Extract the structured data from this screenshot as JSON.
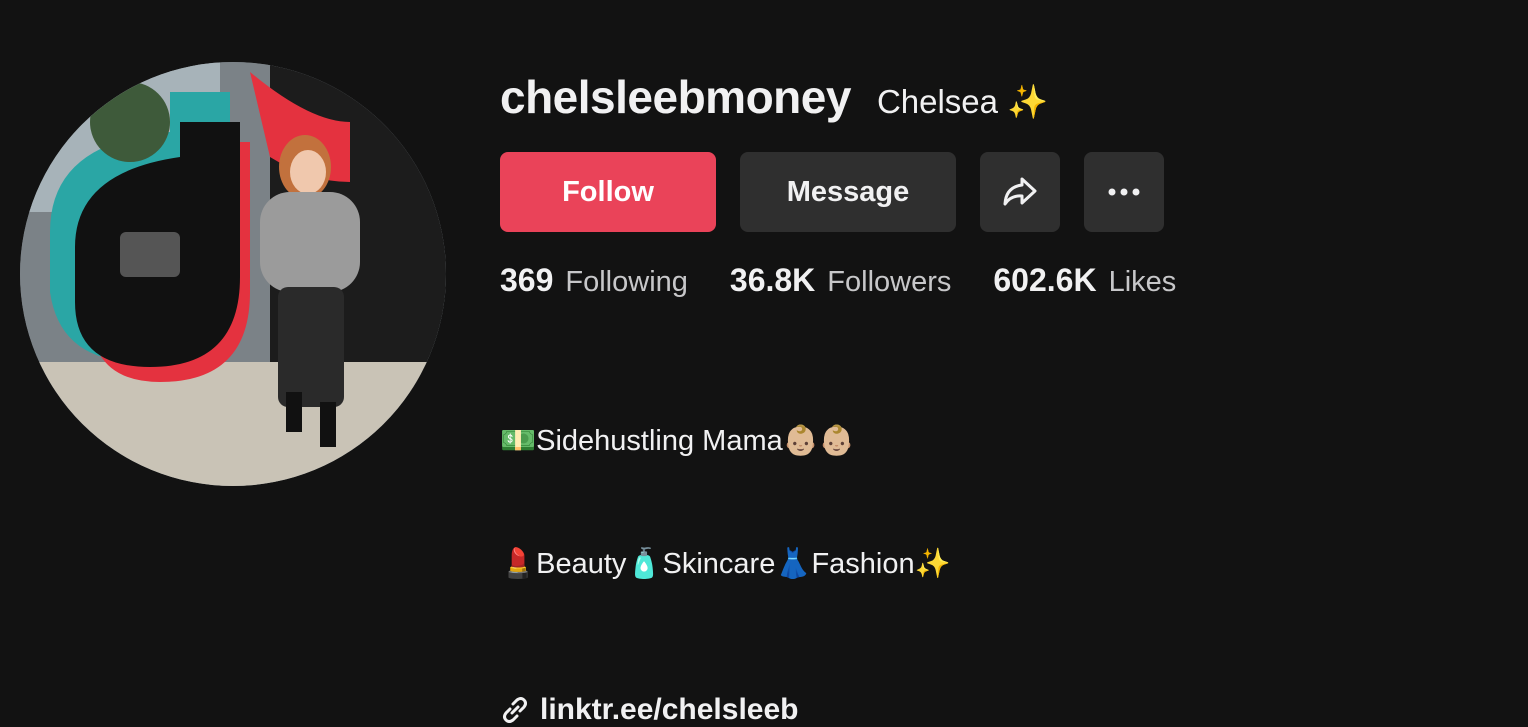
{
  "profile": {
    "username": "chelsleebmoney",
    "nickname": "Chelsea ✨",
    "avatar_alt": "profile-photo"
  },
  "actions": {
    "follow_label": "Follow",
    "message_label": "Message",
    "share_icon": "share-icon",
    "more_icon": "more-icon"
  },
  "stats": [
    {
      "value": "369",
      "label": "Following"
    },
    {
      "value": "36.8K",
      "label": "Followers"
    },
    {
      "value": "602.6K",
      "label": "Likes"
    }
  ],
  "bio": {
    "line1": "💵Sidehustling Mama👶🏼👶🏼",
    "line2": "💄Beauty🧴Skincare👗Fashion✨"
  },
  "link": {
    "icon": "link-icon",
    "text": "linktr.ee/chelsleeb"
  },
  "colors": {
    "background": "#121212",
    "follow": "#ea4359",
    "secondary_button": "#2f2f2f"
  }
}
